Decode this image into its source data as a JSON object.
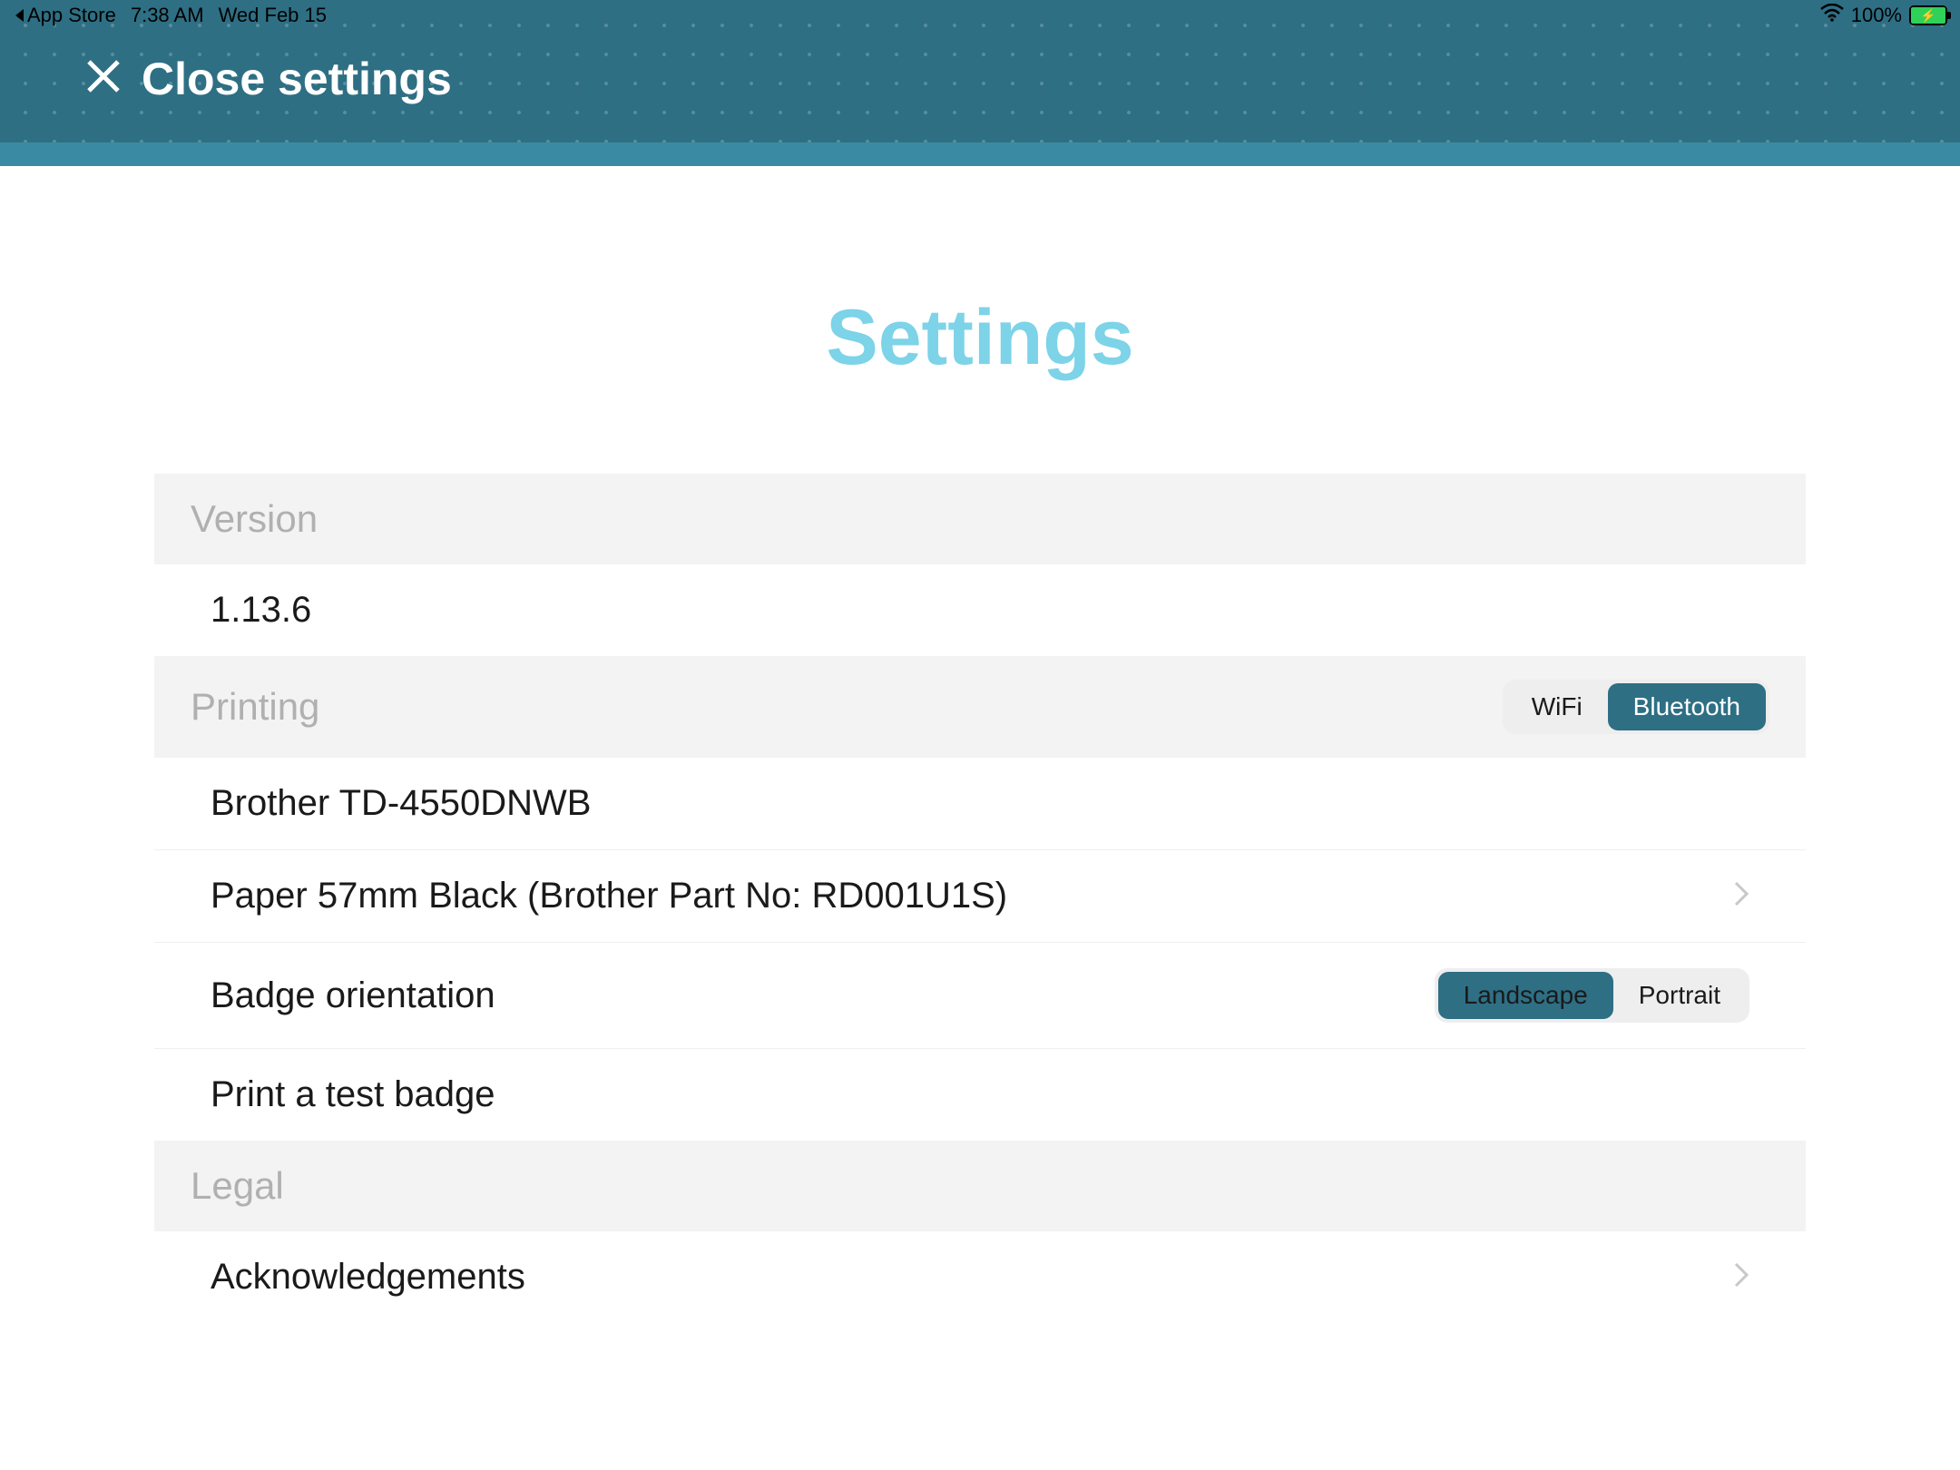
{
  "status_bar": {
    "back_label": "App Store",
    "time": "7:38 AM",
    "date": "Wed Feb 15",
    "battery_percent": "100%"
  },
  "header": {
    "close_label": "Close settings"
  },
  "page": {
    "title": "Settings"
  },
  "sections": {
    "version": {
      "header": "Version",
      "value": "1.13.6"
    },
    "printing": {
      "header": "Printing",
      "connection_options": {
        "wifi": "WiFi",
        "bluetooth": "Bluetooth"
      },
      "connection_selected": "bluetooth",
      "printer": "Brother TD-4550DNWB",
      "paper": "Paper 57mm Black (Brother Part No: RD001U1S)",
      "orientation_label": "Badge orientation",
      "orientation_options": {
        "landscape": "Landscape",
        "portrait": "Portrait"
      },
      "orientation_selected": "landscape",
      "test_badge": "Print a test badge"
    },
    "legal": {
      "header": "Legal",
      "acknowledgements": "Acknowledgements"
    }
  }
}
